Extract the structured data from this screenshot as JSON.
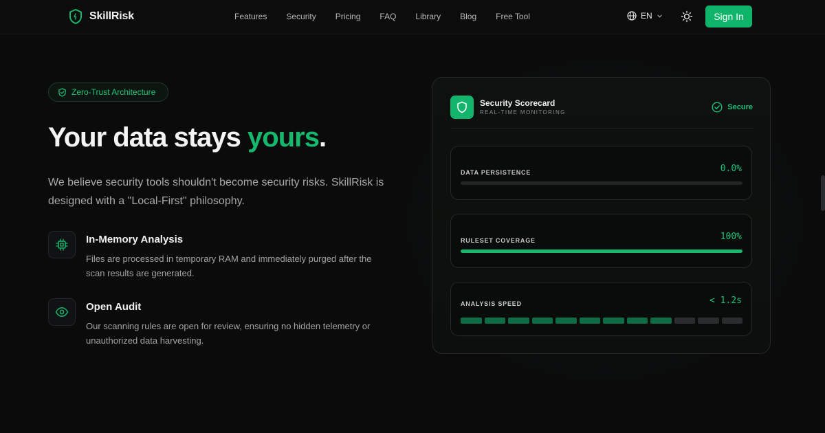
{
  "brand": {
    "name": "SkillRisk",
    "accent": "#10b36a"
  },
  "nav": {
    "links": [
      "Features",
      "Security",
      "Pricing",
      "FAQ",
      "Library",
      "Blog",
      "Free Tool"
    ],
    "language": "EN",
    "sign_in": "Sign In"
  },
  "hero": {
    "badge": "Zero-Trust Architecture",
    "headline_main": "Your data stays ",
    "headline_accent": "yours",
    "headline_end": ".",
    "lead": "We believe security tools shouldn't become security risks. SkillRisk is designed with a \"Local-First\" philosophy."
  },
  "features": [
    {
      "icon": "chip-icon",
      "title": "In-Memory Analysis",
      "desc": "Files are processed in temporary RAM and immediately purged after the scan results are generated."
    },
    {
      "icon": "eye-icon",
      "title": "Open Audit",
      "desc": "Our scanning rules are open for review, ensuring no hidden telemetry or unauthorized data harvesting."
    }
  ],
  "scorecard": {
    "title": "Security Scorecard",
    "subtitle": "REAL-TIME MONITORING",
    "status": "Secure",
    "metrics": [
      {
        "label": "DATA PERSISTENCE",
        "value": "0.0%",
        "fill": 0.0
      },
      {
        "label": "RULESET COVERAGE",
        "value": "100%",
        "fill": 1.0
      },
      {
        "label": "ANALYSIS SPEED",
        "value": "< 1.2s",
        "segments_total": 12,
        "segments_on": 9
      }
    ]
  }
}
